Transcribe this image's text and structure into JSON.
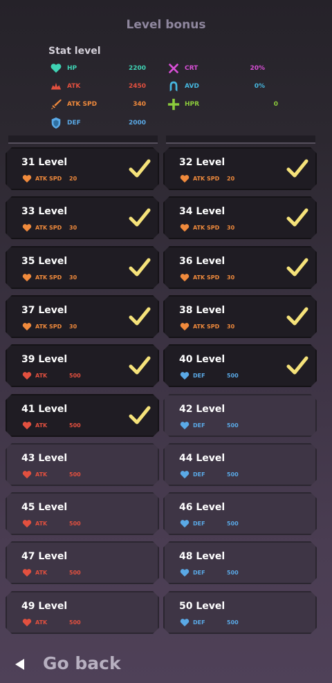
{
  "header": {
    "title": "Level bonus"
  },
  "stat_level": {
    "label": "Stat level",
    "stats": [
      {
        "icon": "heart-icon",
        "label": "HP",
        "value": "2200",
        "color": "#3fd3b4"
      },
      {
        "icon": "atk-icon",
        "label": "ATK",
        "value": "2450",
        "color": "#e2503f"
      },
      {
        "icon": "sword-icon",
        "label": "ATK SPD",
        "value": "340",
        "color": "#f08a3c"
      },
      {
        "icon": "shield-icon",
        "label": "DEF",
        "value": "2000",
        "color": "#5aa9e6"
      },
      {
        "icon": "crossed-swords-icon",
        "label": "CRT",
        "value": "20%",
        "color": "#d84fd6"
      },
      {
        "icon": "avoid-icon",
        "label": "AVD",
        "value": "0%",
        "color": "#46b8e0"
      },
      {
        "icon": "regen-icon",
        "label": "HPR",
        "value": "0",
        "color": "#8ccc3c"
      }
    ]
  },
  "levels": [
    {
      "label": "31 Level",
      "bonus": "ATK SPD",
      "value": "20",
      "color": "#f08a3c",
      "done": true
    },
    {
      "label": "32 Level",
      "bonus": "ATK SPD",
      "value": "20",
      "color": "#f08a3c",
      "done": true
    },
    {
      "label": "33 Level",
      "bonus": "ATK SPD",
      "value": "30",
      "color": "#f08a3c",
      "done": true
    },
    {
      "label": "34 Level",
      "bonus": "ATK SPD",
      "value": "30",
      "color": "#f08a3c",
      "done": true
    },
    {
      "label": "35 Level",
      "bonus": "ATK SPD",
      "value": "30",
      "color": "#f08a3c",
      "done": true
    },
    {
      "label": "36 Level",
      "bonus": "ATK SPD",
      "value": "30",
      "color": "#f08a3c",
      "done": true
    },
    {
      "label": "37 Level",
      "bonus": "ATK SPD",
      "value": "30",
      "color": "#f08a3c",
      "done": true
    },
    {
      "label": "38 Level",
      "bonus": "ATK SPD",
      "value": "30",
      "color": "#f08a3c",
      "done": true
    },
    {
      "label": "39 Level",
      "bonus": "ATK",
      "value": "500",
      "color": "#e2503f",
      "done": true
    },
    {
      "label": "40 Level",
      "bonus": "DEF",
      "value": "500",
      "color": "#5aa9e6",
      "done": true
    },
    {
      "label": "41 Level",
      "bonus": "ATK",
      "value": "500",
      "color": "#e2503f",
      "done": true
    },
    {
      "label": "42 Level",
      "bonus": "DEF",
      "value": "500",
      "color": "#5aa9e6",
      "done": false
    },
    {
      "label": "43 Level",
      "bonus": "ATK",
      "value": "500",
      "color": "#e2503f",
      "done": false
    },
    {
      "label": "44 Level",
      "bonus": "DEF",
      "value": "500",
      "color": "#5aa9e6",
      "done": false
    },
    {
      "label": "45 Level",
      "bonus": "ATK",
      "value": "500",
      "color": "#e2503f",
      "done": false
    },
    {
      "label": "46 Level",
      "bonus": "DEF",
      "value": "500",
      "color": "#5aa9e6",
      "done": false
    },
    {
      "label": "47 Level",
      "bonus": "ATK",
      "value": "500",
      "color": "#e2503f",
      "done": false
    },
    {
      "label": "48 Level",
      "bonus": "DEF",
      "value": "500",
      "color": "#5aa9e6",
      "done": false
    },
    {
      "label": "49 Level",
      "bonus": "ATK",
      "value": "500",
      "color": "#e2503f",
      "done": false
    },
    {
      "label": "50 Level",
      "bonus": "DEF",
      "value": "500",
      "color": "#5aa9e6",
      "done": false
    }
  ],
  "footer": {
    "back_label": "Go back",
    "back_icon": "back-arrow-icon"
  }
}
